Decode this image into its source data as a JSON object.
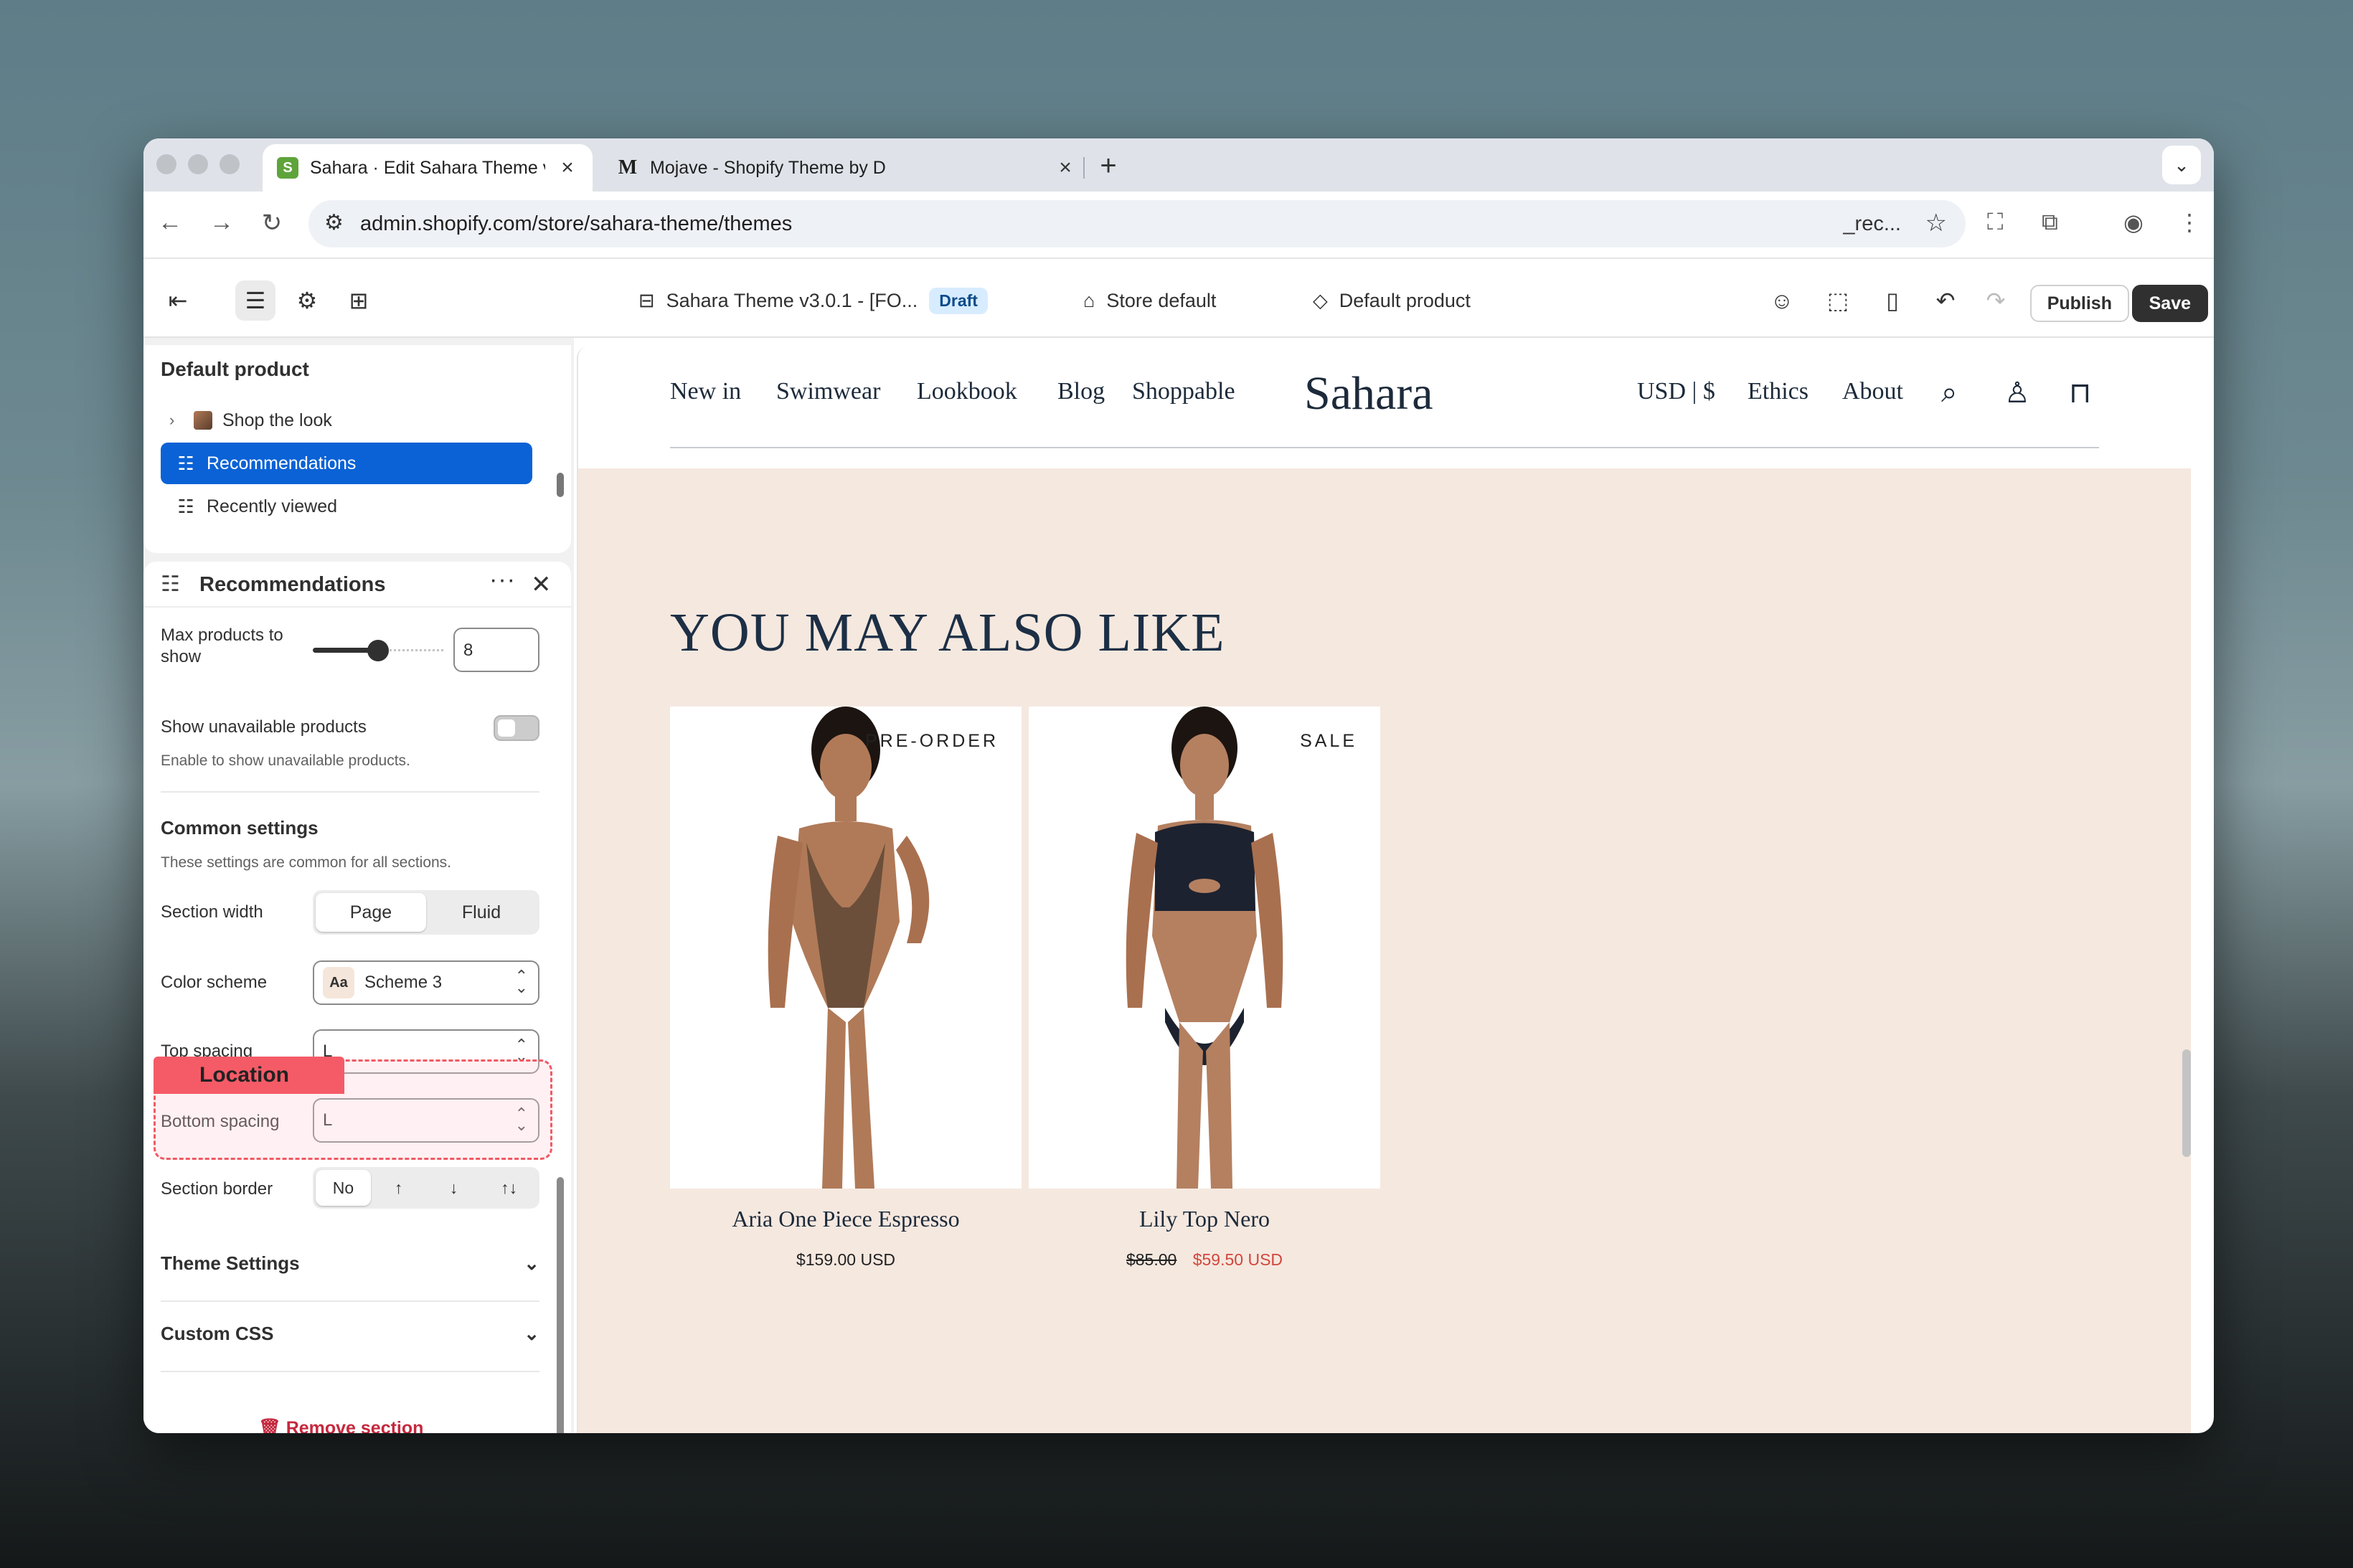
{
  "browser": {
    "tabs": [
      {
        "title": "Sahara · Edit Sahara Theme v",
        "favicon": "shopify-icon",
        "active": true
      },
      {
        "title": "Mojave - Shopify Theme by D",
        "favicon": "m-logo-icon",
        "active": false
      }
    ],
    "url": "admin.shopify.com/store/sahara-theme/themes",
    "url_suffix": "_rec..."
  },
  "editor": {
    "theme_name": "Sahara Theme v3.0.1 - [FO...",
    "status_badge": "Draft",
    "store_context": "Store default",
    "product_context": "Default product",
    "publish_label": "Publish",
    "save_label": "Save"
  },
  "sidebar": {
    "template_title": "Default product",
    "tree": [
      {
        "label": "Shop the look",
        "selected": false
      },
      {
        "label": "Recommendations",
        "selected": true
      },
      {
        "label": "Recently viewed",
        "selected": false
      }
    ],
    "settings": {
      "title": "Recommendations",
      "max_products_label": "Max products to show",
      "max_products_value": "8",
      "max_products_fraction": 0.35,
      "show_unavailable_label": "Show unavailable products",
      "show_unavailable_help": "Enable to show unavailable products.",
      "show_unavailable_on": false,
      "common_title": "Common settings",
      "common_help": "These settings are common for all sections.",
      "section_width_label": "Section width",
      "section_width_options": [
        "Page",
        "Fluid"
      ],
      "section_width_selected": "Page",
      "color_scheme_label": "Color scheme",
      "color_scheme_swatch": "Aa",
      "color_scheme_value": "Scheme 3",
      "top_spacing_label": "Top spacing",
      "top_spacing_value": "L",
      "bottom_spacing_label": "Bottom spacing",
      "bottom_spacing_value": "L",
      "section_border_label": "Section border",
      "section_border_options": [
        "No",
        "↑",
        "↓",
        "↑↓"
      ],
      "section_border_selected": "No",
      "location_tag": "Location",
      "theme_settings_label": "Theme Settings",
      "custom_css_label": "Custom CSS",
      "remove_label": "Remove section"
    }
  },
  "store": {
    "nav_left": [
      "New in",
      "Swimwear",
      "Lookbook",
      "Blog",
      "Shoppable"
    ],
    "logo": "Sahara",
    "nav_right": [
      "USD | $",
      "Ethics",
      "About"
    ],
    "heading": "YOU MAY ALSO LIKE",
    "products": [
      {
        "name": "Aria One Piece Espresso",
        "tag": "PRE-ORDER",
        "price": "$159.00 USD",
        "compare_price": "",
        "swimsuit_color": "#6b4f3a"
      },
      {
        "name": "Lily Top Nero",
        "tag": "SALE",
        "price": "$59.50 USD",
        "compare_price": "$85.00",
        "swimsuit_color": "#1d2230"
      }
    ],
    "colors": {
      "background": "#f5e8df",
      "text": "#1c2f45",
      "sale": "#d2463c"
    }
  }
}
